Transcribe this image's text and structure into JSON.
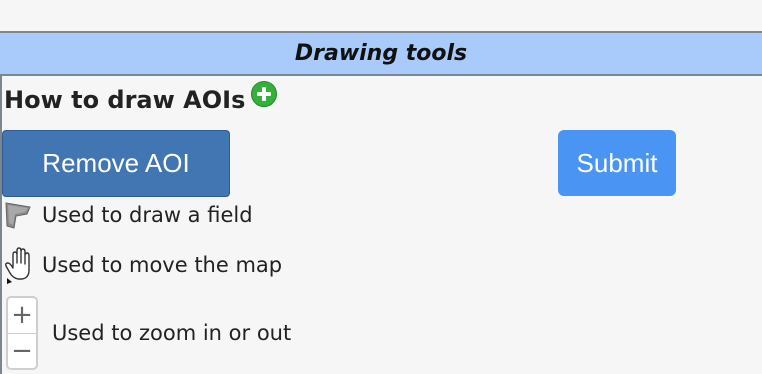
{
  "header": {
    "title": "Drawing tools"
  },
  "howto": {
    "label": "How to draw AOIs",
    "icon": "plus-circle-icon",
    "icon_color": "#36b03c"
  },
  "buttons": {
    "remove_label": "Remove AOI",
    "submit_label": "Submit",
    "remove_color": "#4176b3",
    "submit_color": "#4a94f4"
  },
  "tools": [
    {
      "icon": "polygon-draw-icon",
      "text": "Used to draw a field"
    },
    {
      "icon": "hand-pan-icon",
      "text": "Used to move the map"
    },
    {
      "icon": "zoom-control-icon",
      "text": "Used to zoom in or out",
      "zoom_in": "+",
      "zoom_out": "−"
    }
  ],
  "colors": {
    "header_bg": "#a9cbfb",
    "page_bg": "#f6f6f6"
  }
}
